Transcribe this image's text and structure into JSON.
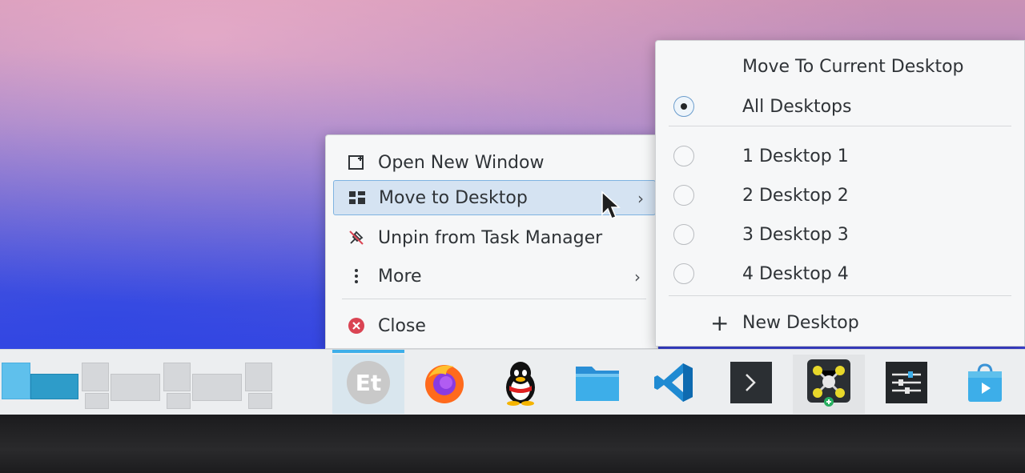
{
  "context_menu": {
    "items": [
      {
        "label": "Open New Window",
        "icon": "new-window-icon"
      },
      {
        "label": "Move to Desktop",
        "icon": "desktops-icon",
        "has_submenu": true,
        "highlighted": true
      },
      {
        "label": "Unpin from Task Manager",
        "icon": "unpin-icon"
      },
      {
        "label": "More",
        "icon": "more-vertical-icon",
        "has_submenu": true
      },
      {
        "label": "Close",
        "icon": "close-circle-icon"
      }
    ]
  },
  "submenu": {
    "move_current": "Move To Current Desktop",
    "all_desktops": "All Desktops",
    "all_desktops_selected": true,
    "desktops": [
      {
        "label": "1 Desktop 1"
      },
      {
        "label": "2 Desktop 2"
      },
      {
        "label": "3 Desktop 3"
      },
      {
        "label": "4 Desktop 4"
      }
    ],
    "new_desktop": "New Desktop"
  },
  "taskbar": {
    "apps": [
      {
        "name": "eudic-icon",
        "current": true
      },
      {
        "name": "firefox-icon"
      },
      {
        "name": "qq-icon"
      },
      {
        "name": "file-manager-icon"
      },
      {
        "name": "vscode-icon"
      },
      {
        "name": "terminal-icon"
      },
      {
        "name": "molecule-app-icon"
      },
      {
        "name": "settings-sliders-icon"
      },
      {
        "name": "app-store-icon"
      }
    ]
  },
  "colors": {
    "accent": "#3daee9",
    "highlight_bg": "#d5e3f2",
    "close_red": "#da4453"
  }
}
